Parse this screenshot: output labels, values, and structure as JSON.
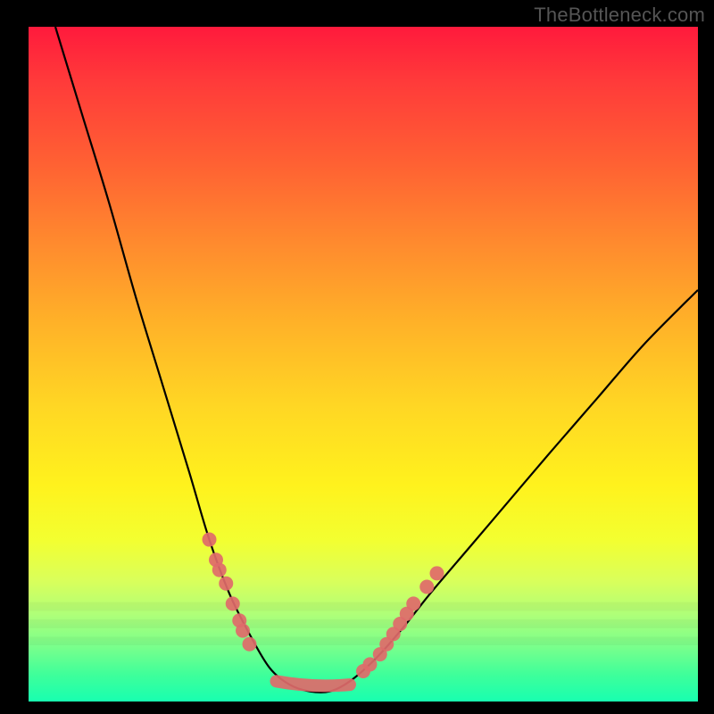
{
  "watermark": "TheBottleneck.com",
  "colors": {
    "gradient_top": "#ff1a3c",
    "gradient_bottom": "#18ffb0",
    "curve": "#000000",
    "highlight": "#e06a6a",
    "background": "#000000"
  },
  "chart_data": {
    "type": "line",
    "title": "",
    "xlabel": "",
    "ylabel": "",
    "x_range": [
      0,
      1
    ],
    "y_range": [
      0,
      1
    ],
    "curve_points": [
      {
        "x": 0.04,
        "y": 1.0
      },
      {
        "x": 0.08,
        "y": 0.87
      },
      {
        "x": 0.12,
        "y": 0.74
      },
      {
        "x": 0.16,
        "y": 0.6
      },
      {
        "x": 0.2,
        "y": 0.47
      },
      {
        "x": 0.24,
        "y": 0.34
      },
      {
        "x": 0.27,
        "y": 0.24
      },
      {
        "x": 0.3,
        "y": 0.16
      },
      {
        "x": 0.33,
        "y": 0.1
      },
      {
        "x": 0.36,
        "y": 0.05
      },
      {
        "x": 0.39,
        "y": 0.025
      },
      {
        "x": 0.42,
        "y": 0.015
      },
      {
        "x": 0.45,
        "y": 0.015
      },
      {
        "x": 0.48,
        "y": 0.03
      },
      {
        "x": 0.52,
        "y": 0.065
      },
      {
        "x": 0.56,
        "y": 0.11
      },
      {
        "x": 0.6,
        "y": 0.16
      },
      {
        "x": 0.66,
        "y": 0.23
      },
      {
        "x": 0.72,
        "y": 0.3
      },
      {
        "x": 0.78,
        "y": 0.37
      },
      {
        "x": 0.85,
        "y": 0.45
      },
      {
        "x": 0.92,
        "y": 0.53
      },
      {
        "x": 1.0,
        "y": 0.61
      }
    ],
    "highlight_clusters_left": [
      {
        "x": 0.27,
        "y": 0.24
      },
      {
        "x": 0.28,
        "y": 0.21
      },
      {
        "x": 0.285,
        "y": 0.195
      },
      {
        "x": 0.295,
        "y": 0.175
      },
      {
        "x": 0.305,
        "y": 0.145
      },
      {
        "x": 0.315,
        "y": 0.12
      },
      {
        "x": 0.32,
        "y": 0.105
      },
      {
        "x": 0.33,
        "y": 0.085
      }
    ],
    "highlight_clusters_right": [
      {
        "x": 0.5,
        "y": 0.045
      },
      {
        "x": 0.51,
        "y": 0.055
      },
      {
        "x": 0.525,
        "y": 0.07
      },
      {
        "x": 0.535,
        "y": 0.085
      },
      {
        "x": 0.545,
        "y": 0.1
      },
      {
        "x": 0.555,
        "y": 0.115
      },
      {
        "x": 0.565,
        "y": 0.13
      },
      {
        "x": 0.575,
        "y": 0.145
      },
      {
        "x": 0.595,
        "y": 0.17
      },
      {
        "x": 0.61,
        "y": 0.19
      }
    ],
    "highlight_valley_segment": {
      "x1": 0.37,
      "y1": 0.03,
      "x2": 0.48,
      "y2": 0.025
    }
  }
}
